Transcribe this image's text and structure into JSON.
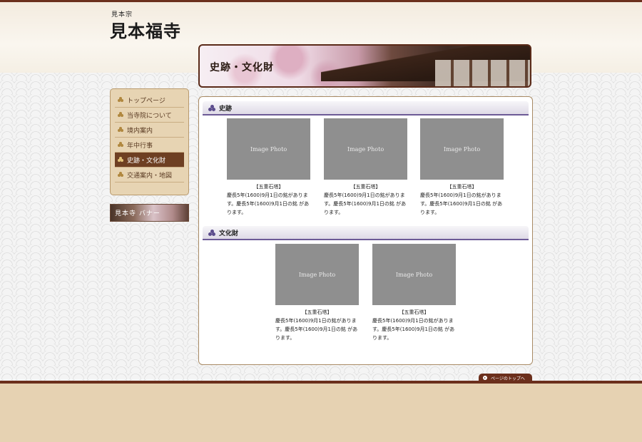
{
  "site": {
    "subtitle": "見本宗",
    "title": "見本福寺"
  },
  "hero": {
    "title": "史跡・文化財"
  },
  "nav": {
    "items": [
      {
        "label": "トップページ",
        "active": false
      },
      {
        "label": "当寺院について",
        "active": false
      },
      {
        "label": "境内案内",
        "active": false
      },
      {
        "label": "年中行事",
        "active": false
      },
      {
        "label": "史跡・文化財",
        "active": true
      },
      {
        "label": "交通案内・地図",
        "active": false
      }
    ]
  },
  "side_banner": {
    "label": "見本寺 バナー"
  },
  "sections": [
    {
      "heading": "史跡",
      "cards": [
        {
          "photo": "Image Photo",
          "title": "【五重石塔】",
          "text": "慶長5年(1600)9月1日の銘がありま す。慶長5年(1600)9月1日の銘 があります。"
        },
        {
          "photo": "Image Photo",
          "title": "【五重石塔】",
          "text": "慶長5年(1600)9月1日の銘がありま す。慶長5年(1600)9月1日の銘 があります。"
        },
        {
          "photo": "Image Photo",
          "title": "【五重石塔】",
          "text": "慶長5年(1600)9月1日の銘がありま す。慶長5年(1600)9月1日の銘 があります。"
        }
      ]
    },
    {
      "heading": "文化財",
      "cards": [
        {
          "photo": "Image Photo",
          "title": "【五重石塔】",
          "text": "慶長5年(1600)9月1日の銘がありま す。慶長5年(1600)9月1日の銘 があります。"
        },
        {
          "photo": "Image Photo",
          "title": "【五重石塔】",
          "text": "慶長5年(1600)9月1日の銘がありま す。慶長5年(1600)9月1日の銘 があります。"
        }
      ]
    }
  ],
  "pagetop": {
    "label": "ページのトップへ"
  },
  "colors": {
    "accent_brown": "#6b2f1c",
    "nav_active": "#6e3f22",
    "section_line": "#6c5a96"
  }
}
